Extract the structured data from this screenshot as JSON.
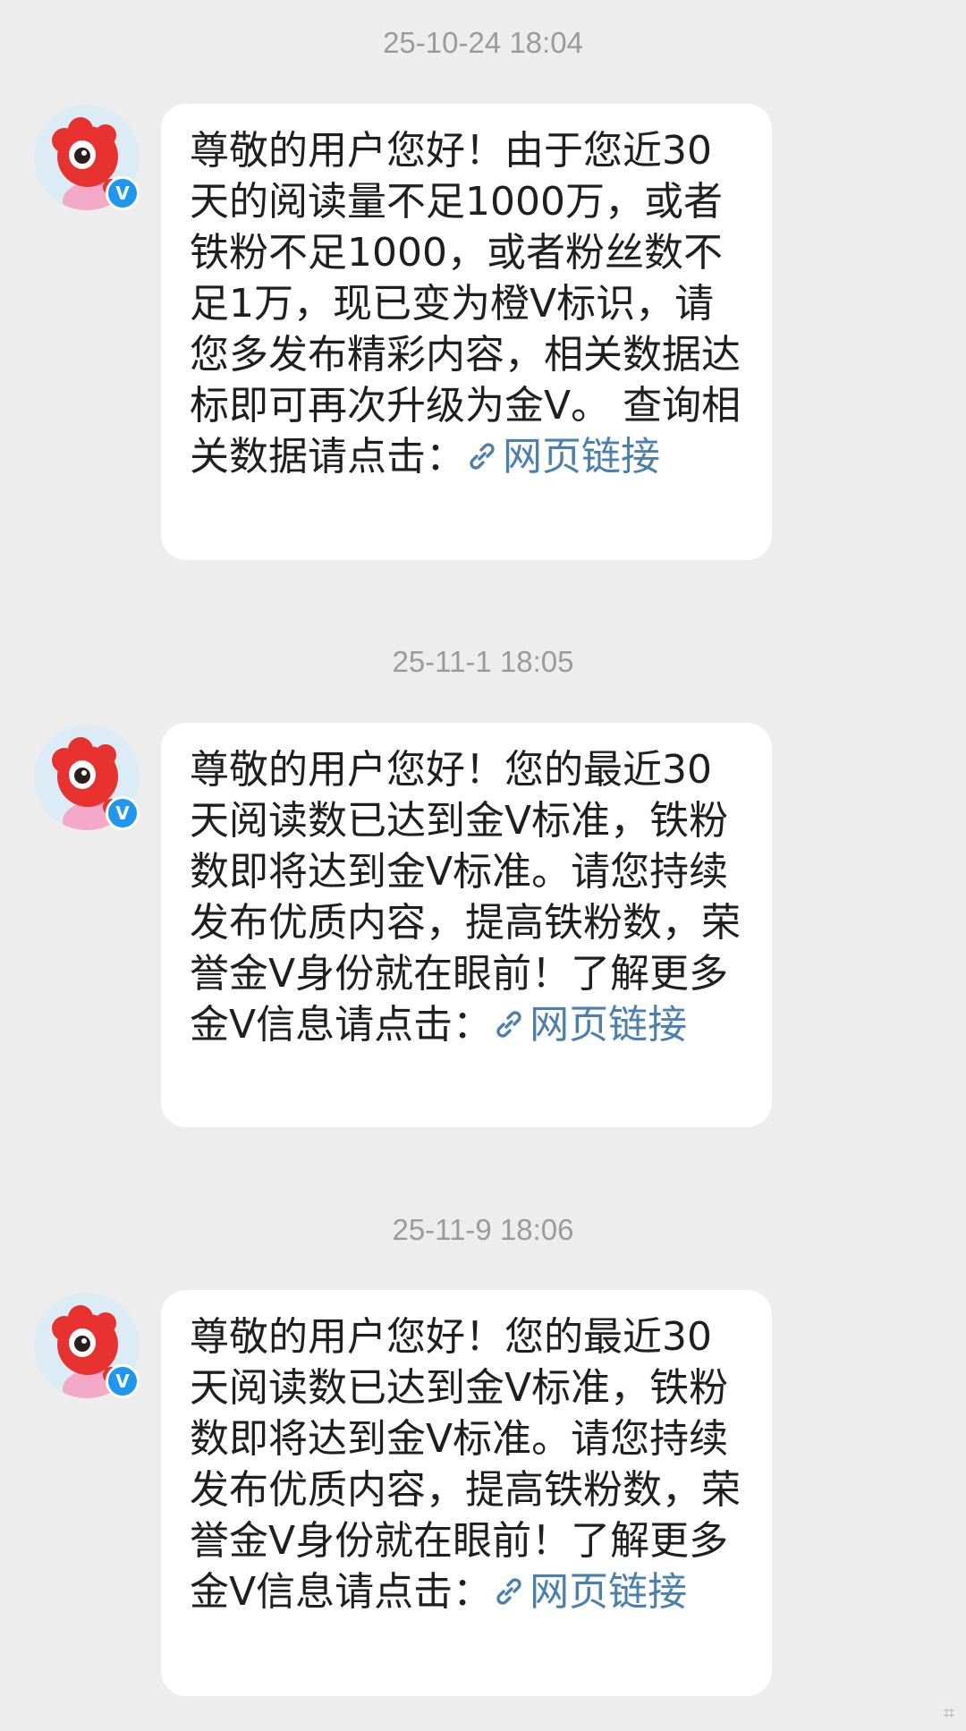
{
  "messages": [
    {
      "timestamp": "25-10-24 18:04",
      "text": "尊敬的用户您好！由于您近30天的阅读量不足1000万，或者铁粉不足1000，或者粉丝数不足1万，现已变为橙V标识，请您多发布精彩内容，相关数据达标即可再次升级为金V。 查询相关数据请点击：",
      "link_label": "网页链接",
      "verified_badge": "V"
    },
    {
      "timestamp": "25-11-1 18:05",
      "text": "尊敬的用户您好！您的最近30天阅读数已达到金V标准，铁粉数即将达到金V标准。请您持续发布优质内容，提高铁粉数，荣誉金V身份就在眼前！了解更多金V信息请点击：",
      "link_label": "网页链接",
      "verified_badge": "V"
    },
    {
      "timestamp": "25-11-9 18:06",
      "text": "尊敬的用户您好！您的最近30天阅读数已达到金V标准，铁粉数即将达到金V标准。请您持续发布优质内容，提高铁粉数，荣誉金V身份就在眼前！了解更多金V信息请点击：",
      "link_label": "网页链接",
      "verified_badge": "V"
    }
  ],
  "colors": {
    "background": "#ededed",
    "bubble": "#ffffff",
    "text": "#1f1f1f",
    "link": "#4a7fb0",
    "timestamp": "#9b9b9b",
    "verified_badge": "#1f97ee"
  },
  "icons": {
    "avatar": "weibo-mascot-avatar-icon",
    "verified": "verified-v-badge-icon",
    "link": "chain-link-icon"
  }
}
